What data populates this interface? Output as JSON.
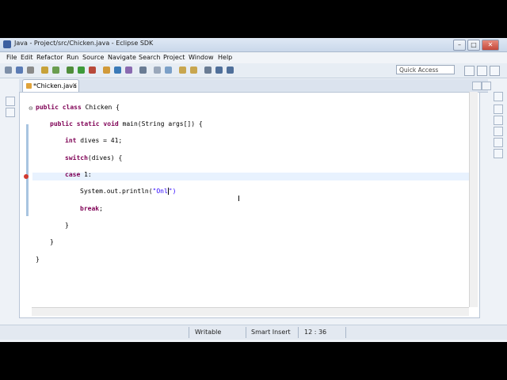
{
  "window": {
    "title": "Java - Project/src/Chicken.java - Eclipse SDK"
  },
  "window_buttons": {
    "minimize": "–",
    "maximize": "□",
    "close": "✕"
  },
  "menu": [
    "File",
    "Edit",
    "Refactor",
    "Run",
    "Source",
    "Navigate",
    "Search",
    "Project",
    "Window",
    "Help"
  ],
  "toolbar": {
    "quick_access": "Quick Access"
  },
  "editor": {
    "tab_label": "*Chicken.java",
    "tab_close": "✕",
    "code": {
      "l1_kw": "public class",
      "l1_rest": " Chicken {",
      "l2_kw": "public static void",
      "l2_rest": " main(String args[]) {",
      "l3_kw": "int",
      "l3_rest": " dives = 41;",
      "l4_kw": "switch",
      "l4_rest": "(dives) {",
      "l5_kw": "case",
      "l5_rest": " 1:",
      "l6_pre": "System.out.println(",
      "l6_str_a": "\"Onl",
      "l6_str_b": "\")",
      "l7_kw": "break",
      "l7_rest": ";",
      "l8": "}",
      "l9": "}",
      "l10": "}"
    }
  },
  "status": {
    "writable": "Writable",
    "insert_mode": "Smart Insert",
    "position": "12 : 36"
  },
  "colors": {
    "keyword": "#7f0055",
    "string": "#2a00ff",
    "error": "#d23a2f",
    "current_line": "#e8f2fe"
  }
}
